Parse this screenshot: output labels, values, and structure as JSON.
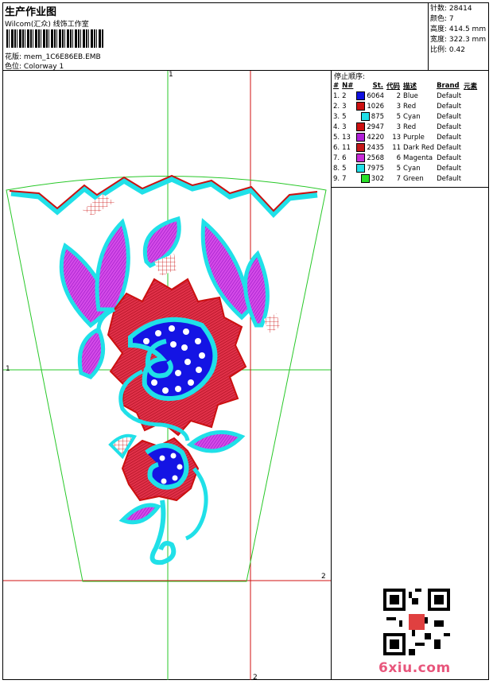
{
  "header": {
    "title": "生产作业图",
    "subtitle": "Wilcom(汇众) 线饰工作室",
    "design_label": "花版:",
    "design_value": "mem_1C6E86EB.EMB",
    "colorway_label": "色位:",
    "colorway_value": "Colorway 1"
  },
  "info": {
    "stitches_label": "针数:",
    "stitches_value": "28414",
    "colors_label": "颜色:",
    "colors_value": "7",
    "height_label": "高度:",
    "height_value": "414.5 mm",
    "width_label": "宽度:",
    "width_value": "322.3 mm",
    "ratio_label": "比例:",
    "ratio_value": "0.42"
  },
  "stop_sequence": {
    "title": "停止顺序:",
    "headers": [
      "#",
      "N#",
      "St.",
      "代码",
      "描述",
      "Brand",
      "元素"
    ],
    "rows": [
      {
        "idx": "1.",
        "n": "2",
        "color": "#1010e0",
        "st": "6064",
        "code": "2",
        "desc": "Blue",
        "brand": "Default"
      },
      {
        "idx": "2.",
        "n": "3",
        "color": "#cc1010",
        "st": "1026",
        "code": "3",
        "desc": "Red",
        "brand": "Default"
      },
      {
        "idx": "3.",
        "n": "5",
        "color": "#20e0e8",
        "st": "875",
        "code": "5",
        "desc": "Cyan",
        "brand": "Default"
      },
      {
        "idx": "4.",
        "n": "3",
        "color": "#cc1010",
        "st": "2947",
        "code": "3",
        "desc": "Red",
        "brand": "Default"
      },
      {
        "idx": "5.",
        "n": "13",
        "color": "#b020d8",
        "st": "4220",
        "code": "13",
        "desc": "Purple",
        "brand": "Default"
      },
      {
        "idx": "6.",
        "n": "11",
        "color": "#c41818",
        "st": "2435",
        "code": "11",
        "desc": "Dark Red",
        "brand": "Default"
      },
      {
        "idx": "7.",
        "n": "6",
        "color": "#c82cd8",
        "st": "2568",
        "code": "6",
        "desc": "Magenta",
        "brand": "Default"
      },
      {
        "idx": "8.",
        "n": "5",
        "color": "#20e0e8",
        "st": "7975",
        "code": "5",
        "desc": "Cyan",
        "brand": "Default"
      },
      {
        "idx": "9.",
        "n": "7",
        "color": "#28e028",
        "st": "302",
        "code": "7",
        "desc": "Green",
        "brand": "Default"
      }
    ]
  },
  "axes": {
    "top_label": "1",
    "left_label": "1",
    "right_label": "2",
    "bottom_label": "2"
  },
  "watermark": "6xiu.com",
  "colors": {
    "guide_green": "#28c828",
    "guide_red": "#d01010",
    "cyan": "#20e0e8",
    "red": "#cc1010",
    "blue": "#1010e0",
    "purple": "#b020d8"
  }
}
